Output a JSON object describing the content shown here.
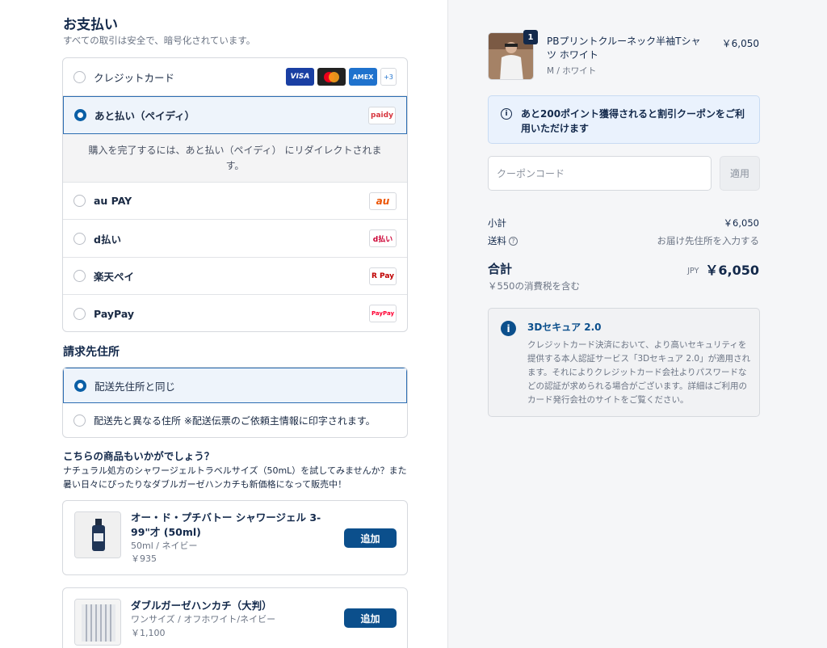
{
  "payment": {
    "title": "お支払い",
    "subtitle": "すべての取引は安全で、暗号化されています。",
    "methods": [
      {
        "label": "クレジットカード",
        "selected": false
      },
      {
        "label": "あと払い（ペイディ）",
        "selected": true
      },
      {
        "label": "au PAY",
        "selected": false
      },
      {
        "label": "d払い",
        "selected": false
      },
      {
        "label": "楽天ペイ",
        "selected": false
      },
      {
        "label": "PayPay",
        "selected": false
      }
    ],
    "card_logos": {
      "visa": "VISA",
      "amex": "AMEX",
      "more": "+3"
    },
    "logos": {
      "poidy": "paidy",
      "au": "au",
      "d": "d払い",
      "rakuten": "R Pay",
      "paypay": "PayPay"
    },
    "redirect_text": "購入を完了するには、あと払い（ペイディ） にリダイレクトされます。"
  },
  "billing": {
    "title": "請求先住所",
    "options": [
      {
        "label": "配送先住所と同じ",
        "selected": true
      },
      {
        "label": "配送先と異なる住所 ※配送伝票のご依頼主情報に印字されます。",
        "selected": false
      }
    ]
  },
  "recommend": {
    "title": "こちらの商品もいかがでしょう？",
    "text": "ナチュラル処方のシャワージェルトラベルサイズ（50mL）を試してみませんか？また暑い日々にぴったりなダブルガーゼハンカチも新価格になって販売中！",
    "products": [
      {
        "name": "オー・ド・プチバトー シャワージェル 3-99\"才 (50ml)",
        "variant": "50ml / ネイビー",
        "price": "￥935",
        "add_label": "追加"
      },
      {
        "name": "ダブルガーゼハンカチ（大判）",
        "variant": "ワンサイズ / オフホワイト/ネイビー",
        "price": "￥1,100",
        "add_label": "追加"
      }
    ]
  },
  "order": {
    "item": {
      "qty": "1",
      "name": "PBプリントクルーネック半袖Tシャツ ホワイト",
      "variant": "M / ホワイト",
      "price": "￥6,050"
    },
    "points_notice": "あと200ポイント獲得されると割引クーポンをご利用いただけます",
    "coupon_placeholder": "クーポンコード",
    "apply_label": "適用",
    "subtotal_label": "小計",
    "subtotal_value": "￥6,050",
    "shipping_label": "送料",
    "shipping_value": "お届け先住所を入力する",
    "total_label": "合計",
    "currency": "JPY",
    "total_value": "￥6,050",
    "tax_note": "￥550の消費税を含む"
  },
  "secure": {
    "title": "3Dセキュア 2.0",
    "body": "クレジットカード決済において、より高いセキュリティを提供する本人認証サービス「3Dセキュア 2.0」が適用されます。それによりクレジットカード会社よりパスワードなどの認証が求められる場合がございます。詳細はご利用のカード発行会社のサイトをご覧ください。"
  },
  "colors": {
    "accent": "#0b4f8c",
    "navy": "#13294b",
    "selected_bg": "#eef4fb"
  }
}
